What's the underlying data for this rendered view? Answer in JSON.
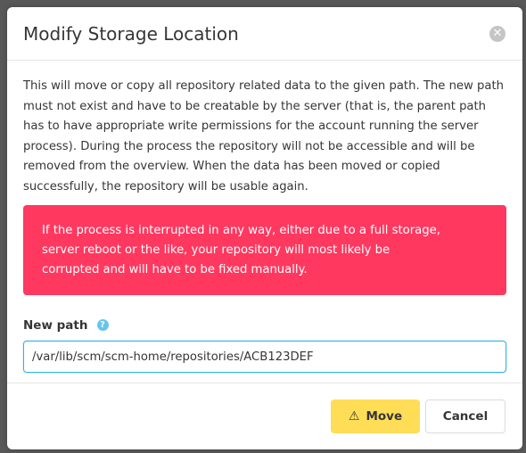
{
  "modal": {
    "title": "Modify Storage Location",
    "close_glyph": "✕",
    "description": "This will move or copy all repository related data to the given path. The new path must not exist and have to be creatable by the server (that is, the parent path has to have appropriate write permissions for the account running the server process). During the process the repository will not be accessible and will be removed from the overview. When the data has been moved or copied successfully, the repository will be usable again.",
    "warning": "If the process is interrupted in any way, either due to a full storage, server reboot or the like, your repository will most likely be corrupted and will have to be fixed manually.",
    "field": {
      "label": "New path",
      "help_glyph": "?",
      "value": "/var/lib/scm/scm-home/repositories/ACB123DEF"
    },
    "footer": {
      "move_icon": "⚠",
      "move_label": "Move",
      "cancel_label": "Cancel"
    }
  },
  "colors": {
    "warning_bg": "#ff3860",
    "primary_button": "#ffdd57",
    "input_focus": "#33b2e8"
  }
}
